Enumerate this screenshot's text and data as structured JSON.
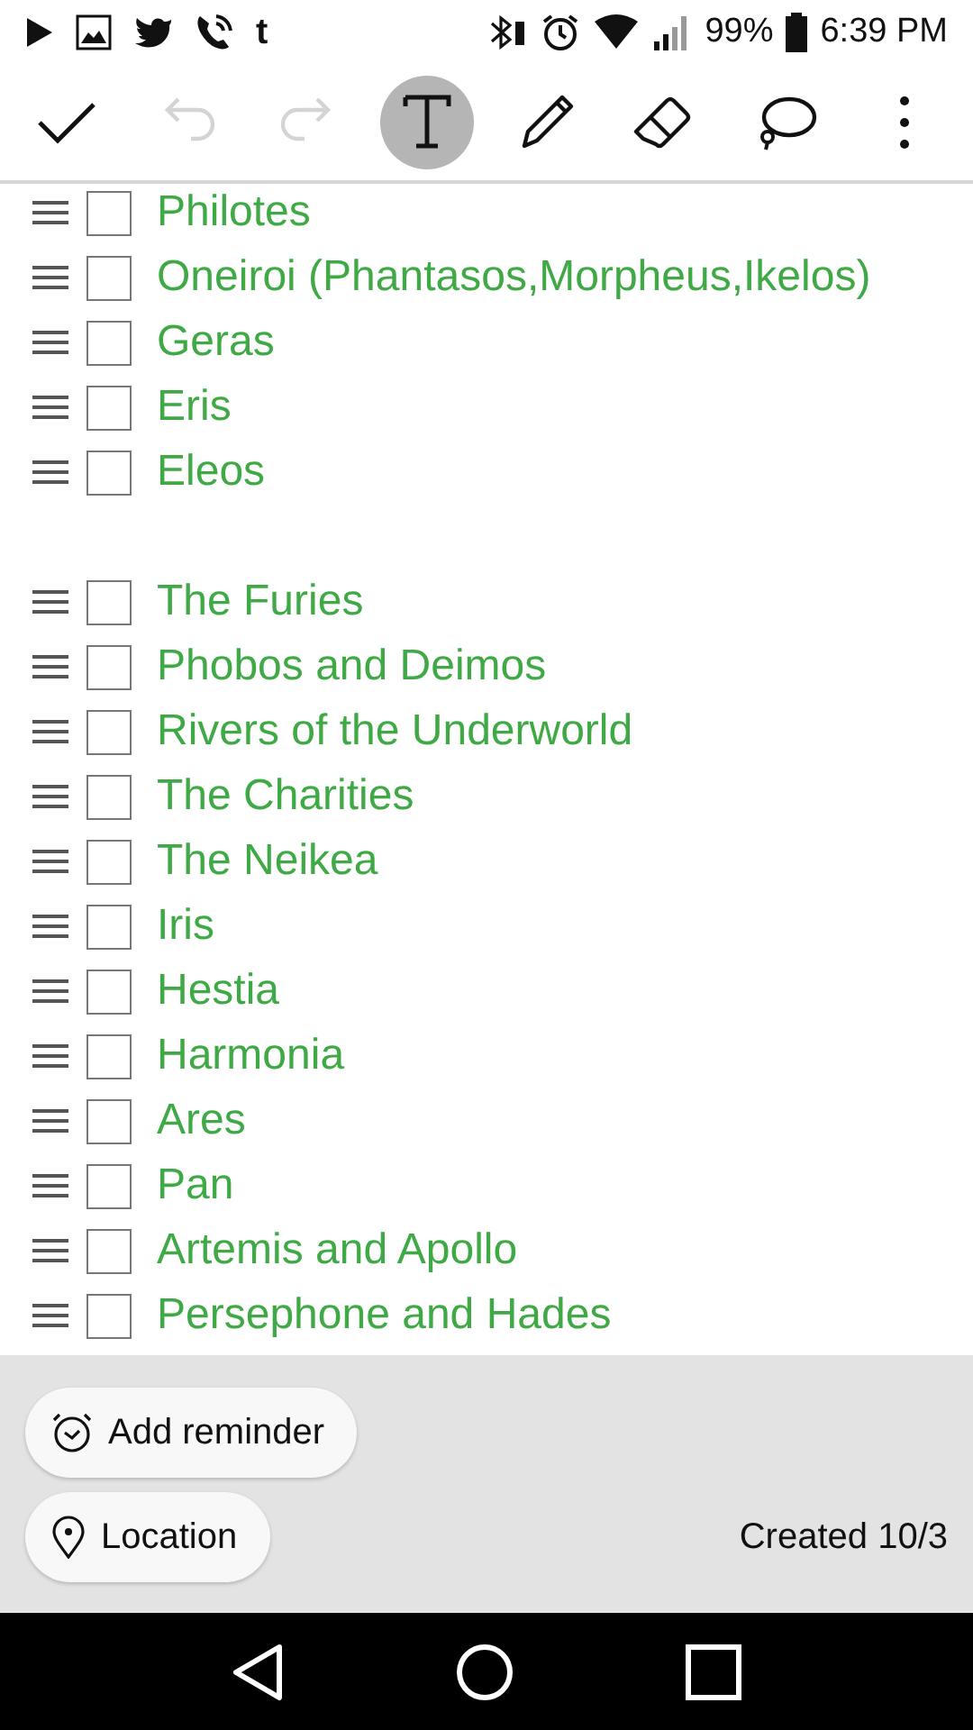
{
  "status_bar": {
    "notification_icons": [
      {
        "kind": "play"
      },
      {
        "kind": "image"
      },
      {
        "kind": "bird"
      },
      {
        "kind": "phone"
      },
      {
        "kind": "glyph",
        "text": "t"
      }
    ],
    "battery_text": "99%",
    "time": "6:39 PM"
  },
  "toolbar": [
    {
      "kind": "check",
      "disabled": false,
      "selected": false
    },
    {
      "kind": "undo",
      "disabled": true,
      "selected": false
    },
    {
      "kind": "redo",
      "disabled": true,
      "selected": false
    },
    {
      "kind": "text",
      "disabled": false,
      "selected": true
    },
    {
      "kind": "pencil",
      "disabled": false,
      "selected": false
    },
    {
      "kind": "eraser",
      "disabled": false,
      "selected": false
    },
    {
      "kind": "lasso",
      "disabled": false,
      "selected": false
    },
    {
      "kind": "more",
      "disabled": false,
      "selected": false
    }
  ],
  "checklist_groups": [
    {
      "items": [
        {
          "text": "Philotes",
          "checked": false
        },
        {
          "text": "Oneiroi (Phantasos,Morpheus,Ikelos)",
          "checked": false
        },
        {
          "text": "Geras",
          "checked": false
        },
        {
          "text": "Eris",
          "checked": false
        },
        {
          "text": "Eleos",
          "checked": false
        }
      ]
    },
    {
      "items": [
        {
          "text": "The Furies",
          "checked": false
        },
        {
          "text": "Phobos and Deimos",
          "checked": false
        },
        {
          "text": "Rivers of the Underworld",
          "checked": false
        },
        {
          "text": "The Charities",
          "checked": false
        },
        {
          "text": "The Neikea",
          "checked": false
        },
        {
          "text": "Iris",
          "checked": false
        },
        {
          "text": "Hestia",
          "checked": false
        },
        {
          "text": "Harmonia",
          "checked": false
        },
        {
          "text": "Ares",
          "checked": false
        },
        {
          "text": "Pan",
          "checked": false
        },
        {
          "text": "Artemis and Apollo",
          "checked": false
        },
        {
          "text": "Persephone and Hades",
          "checked": false
        }
      ]
    }
  ],
  "footer": {
    "reminder_button": "Add reminder",
    "location_button": "Location",
    "created": "Created 10/3"
  }
}
